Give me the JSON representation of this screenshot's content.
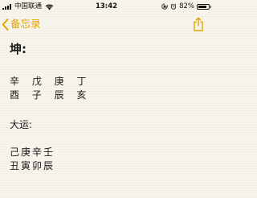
{
  "status_bar": {
    "carrier": "中国联通",
    "time": "13:42",
    "battery_percent": "82%",
    "battery_level": 0.82,
    "signal_icon": "signal-bars-icon",
    "wifi_icon": "wifi-icon",
    "lock_icon": "orientation-lock-icon",
    "alarm_icon": "alarm-icon"
  },
  "nav": {
    "back_label": "备忘录",
    "back_icon": "chevron-left-icon",
    "share_icon": "share-icon",
    "accent_color": "#e2a500"
  },
  "note": {
    "title": "坤:",
    "bazi_row1": "辛 戊 庚 丁",
    "bazi_row2": "酉 子 辰 亥",
    "dayun_label": "大运:",
    "dayun_row1": "己庚辛壬",
    "dayun_row2": "丑寅卯辰"
  }
}
